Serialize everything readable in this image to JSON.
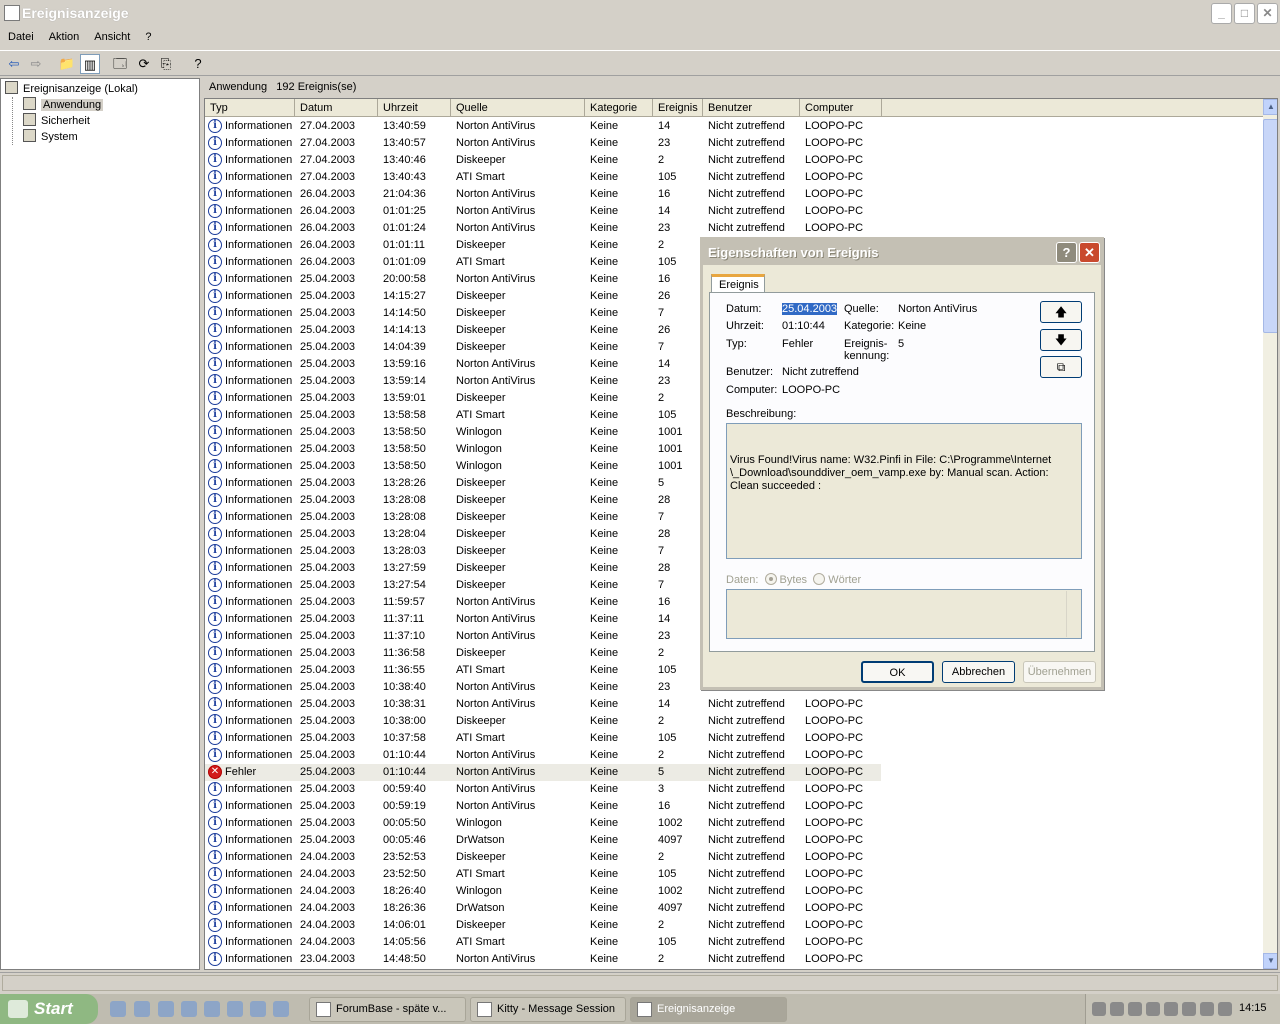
{
  "window": {
    "title": "Ereignisanzeige"
  },
  "menu": [
    "Datei",
    "Aktion",
    "Ansicht",
    "?"
  ],
  "tree": {
    "root": "Ereignisanzeige (Lokal)",
    "items": [
      "Anwendung",
      "Sicherheit",
      "System"
    ]
  },
  "list_header": {
    "log": "Anwendung",
    "count": "192 Ereignis(se)"
  },
  "columns": [
    "Typ",
    "Datum",
    "Uhrzeit",
    "Quelle",
    "Kategorie",
    "Ereignis",
    "Benutzer",
    "Computer"
  ],
  "rows": [
    [
      "Informationen",
      "27.04.2003",
      "13:40:59",
      "Norton AntiVirus",
      "Keine",
      "14",
      "Nicht zutreffend",
      "LOOPO-PC"
    ],
    [
      "Informationen",
      "27.04.2003",
      "13:40:57",
      "Norton AntiVirus",
      "Keine",
      "23",
      "Nicht zutreffend",
      "LOOPO-PC"
    ],
    [
      "Informationen",
      "27.04.2003",
      "13:40:46",
      "Diskeeper",
      "Keine",
      "2",
      "Nicht zutreffend",
      "LOOPO-PC"
    ],
    [
      "Informationen",
      "27.04.2003",
      "13:40:43",
      "ATI Smart",
      "Keine",
      "105",
      "Nicht zutreffend",
      "LOOPO-PC"
    ],
    [
      "Informationen",
      "26.04.2003",
      "21:04:36",
      "Norton AntiVirus",
      "Keine",
      "16",
      "Nicht zutreffend",
      "LOOPO-PC"
    ],
    [
      "Informationen",
      "26.04.2003",
      "01:01:25",
      "Norton AntiVirus",
      "Keine",
      "14",
      "Nicht zutreffend",
      "LOOPO-PC"
    ],
    [
      "Informationen",
      "26.04.2003",
      "01:01:24",
      "Norton AntiVirus",
      "Keine",
      "23",
      "Nicht zutreffend",
      "LOOPO-PC"
    ],
    [
      "Informationen",
      "26.04.2003",
      "01:01:11",
      "Diskeeper",
      "Keine",
      "2",
      "",
      ""
    ],
    [
      "Informationen",
      "26.04.2003",
      "01:01:09",
      "ATI Smart",
      "Keine",
      "105",
      "",
      ""
    ],
    [
      "Informationen",
      "25.04.2003",
      "20:00:58",
      "Norton AntiVirus",
      "Keine",
      "16",
      "",
      ""
    ],
    [
      "Informationen",
      "25.04.2003",
      "14:15:27",
      "Diskeeper",
      "Keine",
      "26",
      "",
      ""
    ],
    [
      "Informationen",
      "25.04.2003",
      "14:14:50",
      "Diskeeper",
      "Keine",
      "7",
      "",
      ""
    ],
    [
      "Informationen",
      "25.04.2003",
      "14:14:13",
      "Diskeeper",
      "Keine",
      "26",
      "",
      ""
    ],
    [
      "Informationen",
      "25.04.2003",
      "14:04:39",
      "Diskeeper",
      "Keine",
      "7",
      "",
      ""
    ],
    [
      "Informationen",
      "25.04.2003",
      "13:59:16",
      "Norton AntiVirus",
      "Keine",
      "14",
      "",
      ""
    ],
    [
      "Informationen",
      "25.04.2003",
      "13:59:14",
      "Norton AntiVirus",
      "Keine",
      "23",
      "",
      ""
    ],
    [
      "Informationen",
      "25.04.2003",
      "13:59:01",
      "Diskeeper",
      "Keine",
      "2",
      "",
      ""
    ],
    [
      "Informationen",
      "25.04.2003",
      "13:58:58",
      "ATI Smart",
      "Keine",
      "105",
      "",
      ""
    ],
    [
      "Informationen",
      "25.04.2003",
      "13:58:50",
      "Winlogon",
      "Keine",
      "1001",
      "",
      ""
    ],
    [
      "Informationen",
      "25.04.2003",
      "13:58:50",
      "Winlogon",
      "Keine",
      "1001",
      "",
      ""
    ],
    [
      "Informationen",
      "25.04.2003",
      "13:58:50",
      "Winlogon",
      "Keine",
      "1001",
      "",
      ""
    ],
    [
      "Informationen",
      "25.04.2003",
      "13:28:26",
      "Diskeeper",
      "Keine",
      "5",
      "",
      ""
    ],
    [
      "Informationen",
      "25.04.2003",
      "13:28:08",
      "Diskeeper",
      "Keine",
      "28",
      "",
      ""
    ],
    [
      "Informationen",
      "25.04.2003",
      "13:28:08",
      "Diskeeper",
      "Keine",
      "7",
      "",
      ""
    ],
    [
      "Informationen",
      "25.04.2003",
      "13:28:04",
      "Diskeeper",
      "Keine",
      "28",
      "",
      ""
    ],
    [
      "Informationen",
      "25.04.2003",
      "13:28:03",
      "Diskeeper",
      "Keine",
      "7",
      "",
      ""
    ],
    [
      "Informationen",
      "25.04.2003",
      "13:27:59",
      "Diskeeper",
      "Keine",
      "28",
      "",
      ""
    ],
    [
      "Informationen",
      "25.04.2003",
      "13:27:54",
      "Diskeeper",
      "Keine",
      "7",
      "",
      ""
    ],
    [
      "Informationen",
      "25.04.2003",
      "11:59:57",
      "Norton AntiVirus",
      "Keine",
      "16",
      "",
      ""
    ],
    [
      "Informationen",
      "25.04.2003",
      "11:37:11",
      "Norton AntiVirus",
      "Keine",
      "14",
      "",
      ""
    ],
    [
      "Informationen",
      "25.04.2003",
      "11:37:10",
      "Norton AntiVirus",
      "Keine",
      "23",
      "",
      ""
    ],
    [
      "Informationen",
      "25.04.2003",
      "11:36:58",
      "Diskeeper",
      "Keine",
      "2",
      "",
      ""
    ],
    [
      "Informationen",
      "25.04.2003",
      "11:36:55",
      "ATI Smart",
      "Keine",
      "105",
      "",
      ""
    ],
    [
      "Informationen",
      "25.04.2003",
      "10:38:40",
      "Norton AntiVirus",
      "Keine",
      "23",
      "",
      ""
    ],
    [
      "Informationen",
      "25.04.2003",
      "10:38:31",
      "Norton AntiVirus",
      "Keine",
      "14",
      "Nicht zutreffend",
      "LOOPO-PC"
    ],
    [
      "Informationen",
      "25.04.2003",
      "10:38:00",
      "Diskeeper",
      "Keine",
      "2",
      "Nicht zutreffend",
      "LOOPO-PC"
    ],
    [
      "Informationen",
      "25.04.2003",
      "10:37:58",
      "ATI Smart",
      "Keine",
      "105",
      "Nicht zutreffend",
      "LOOPO-PC"
    ],
    [
      "Informationen",
      "25.04.2003",
      "01:10:44",
      "Norton AntiVirus",
      "Keine",
      "2",
      "Nicht zutreffend",
      "LOOPO-PC"
    ],
    [
      "Fehler",
      "25.04.2003",
      "01:10:44",
      "Norton AntiVirus",
      "Keine",
      "5",
      "Nicht zutreffend",
      "LOOPO-PC"
    ],
    [
      "Informationen",
      "25.04.2003",
      "00:59:40",
      "Norton AntiVirus",
      "Keine",
      "3",
      "Nicht zutreffend",
      "LOOPO-PC"
    ],
    [
      "Informationen",
      "25.04.2003",
      "00:59:19",
      "Norton AntiVirus",
      "Keine",
      "16",
      "Nicht zutreffend",
      "LOOPO-PC"
    ],
    [
      "Informationen",
      "25.04.2003",
      "00:05:50",
      "Winlogon",
      "Keine",
      "1002",
      "Nicht zutreffend",
      "LOOPO-PC"
    ],
    [
      "Informationen",
      "25.04.2003",
      "00:05:46",
      "DrWatson",
      "Keine",
      "4097",
      "Nicht zutreffend",
      "LOOPO-PC"
    ],
    [
      "Informationen",
      "24.04.2003",
      "23:52:53",
      "Diskeeper",
      "Keine",
      "2",
      "Nicht zutreffend",
      "LOOPO-PC"
    ],
    [
      "Informationen",
      "24.04.2003",
      "23:52:50",
      "ATI Smart",
      "Keine",
      "105",
      "Nicht zutreffend",
      "LOOPO-PC"
    ],
    [
      "Informationen",
      "24.04.2003",
      "18:26:40",
      "Winlogon",
      "Keine",
      "1002",
      "Nicht zutreffend",
      "LOOPO-PC"
    ],
    [
      "Informationen",
      "24.04.2003",
      "18:26:36",
      "DrWatson",
      "Keine",
      "4097",
      "Nicht zutreffend",
      "LOOPO-PC"
    ],
    [
      "Informationen",
      "24.04.2003",
      "14:06:01",
      "Diskeeper",
      "Keine",
      "2",
      "Nicht zutreffend",
      "LOOPO-PC"
    ],
    [
      "Informationen",
      "24.04.2003",
      "14:05:56",
      "ATI Smart",
      "Keine",
      "105",
      "Nicht zutreffend",
      "LOOPO-PC"
    ],
    [
      "Informationen",
      "23.04.2003",
      "14:48:50",
      "Norton AntiVirus",
      "Keine",
      "2",
      "Nicht zutreffend",
      "LOOPO-PC"
    ]
  ],
  "dialog": {
    "title": "Eigenschaften von Ereignis",
    "tab": "Ereignis",
    "datum_label": "Datum:",
    "datum": "25.04.2003",
    "uhrzeit_label": "Uhrzeit:",
    "uhrzeit": "01:10:44",
    "typ_label": "Typ:",
    "typ": "Fehler",
    "benutzer_label": "Benutzer:",
    "benutzer": "Nicht zutreffend",
    "computer_label": "Computer:",
    "computer": "LOOPO-PC",
    "quelle_label": "Quelle:",
    "quelle": "Norton AntiVirus",
    "kategorie_label": "Kategorie:",
    "kategorie": "Keine",
    "kennung_label_1": "Ereignis-",
    "kennung_label_2": "kennung:",
    "kennung": "5",
    "beschreibung_label": "Beschreibung:",
    "beschreibung": "Virus Found!Virus name: W32.Pinfi in File: C:\\Programme\\Internet \\_Download\\sounddiver_oem_vamp.exe by: Manual scan.  Action: Clean succeeded :",
    "daten_label": "Daten:",
    "bytes": "Bytes",
    "woerter": "Wörter",
    "ok": "OK",
    "abbrechen": "Abbrechen",
    "uebernehmen": "Übernehmen"
  },
  "taskbar": {
    "start": "Start",
    "tasks": [
      "ForumBase - späte v...",
      "Kitty - Message Session",
      "Ereignisanzeige"
    ],
    "clock": "14:15"
  }
}
